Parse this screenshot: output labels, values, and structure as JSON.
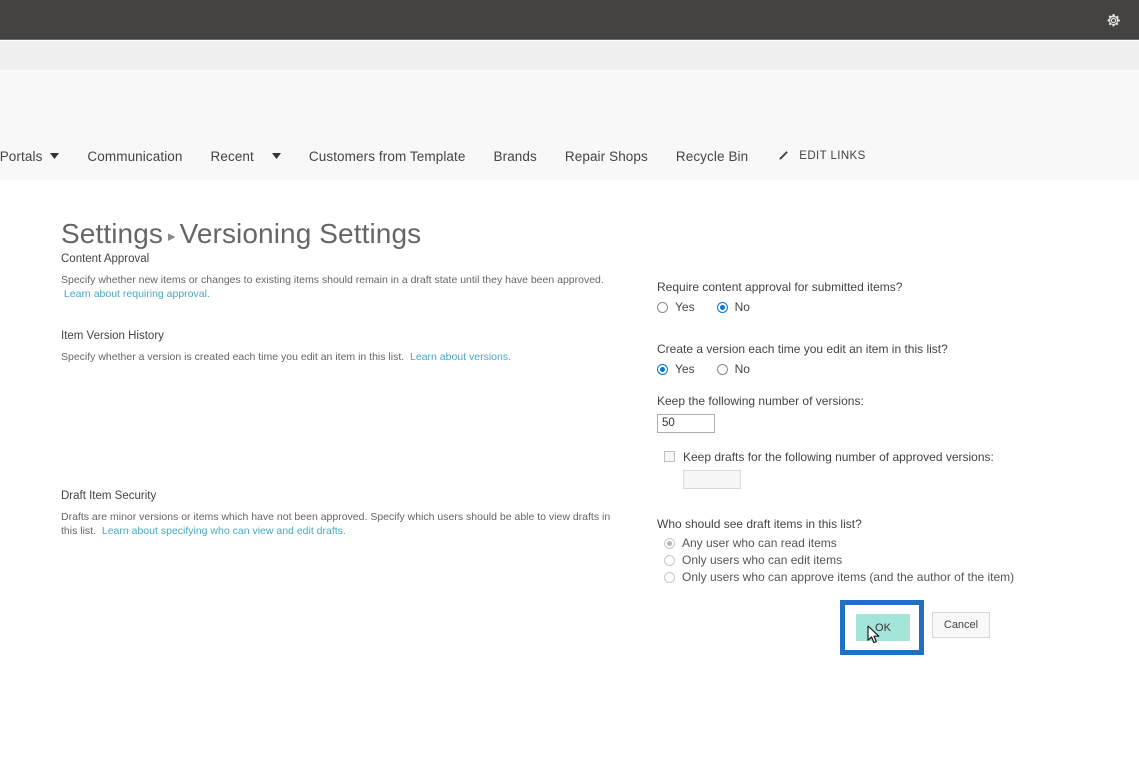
{
  "suite_bar": {
    "gear_icon": "gear-icon"
  },
  "top_nav": {
    "items": [
      {
        "label": "t Portals",
        "has_caret": true
      },
      {
        "label": "Communication",
        "has_caret": false
      },
      {
        "label": "Recent",
        "has_caret": true
      },
      {
        "label": "Customers from Template",
        "has_caret": false
      },
      {
        "label": "Brands",
        "has_caret": false
      },
      {
        "label": "Repair Shops",
        "has_caret": false
      },
      {
        "label": "Recycle Bin",
        "has_caret": false
      }
    ],
    "edit_links": {
      "label": "EDIT LINKS",
      "icon": "pencil-icon"
    }
  },
  "page": {
    "breadcrumb_parent": "Settings",
    "separator": "▸",
    "title": "Versioning Settings"
  },
  "sections": {
    "content_approval": {
      "heading": "Content Approval",
      "description": "Specify whether new items or changes to existing items should remain in a draft state until they have been approved.",
      "link_text": "Learn about requiring approval.",
      "question": "Require content approval for submitted items?",
      "options": [
        {
          "label": "Yes",
          "selected": false
        },
        {
          "label": "No",
          "selected": true
        }
      ]
    },
    "item_version_history": {
      "heading": "Item Version History",
      "description": "Specify whether a version is created each time you edit an item in this list.",
      "link_text": "Learn about versions.",
      "question": "Create a version each time you edit an item in this list?",
      "options": [
        {
          "label": "Yes",
          "selected": true
        },
        {
          "label": "No",
          "selected": false
        }
      ],
      "keep_versions_label": "Keep the following number of versions:",
      "keep_versions_value": "50",
      "keep_drafts_label": "Keep drafts for the following number of approved versions:",
      "keep_drafts_checked": false,
      "keep_drafts_value": ""
    },
    "draft_item_security": {
      "heading": "Draft Item Security",
      "description": "Drafts are minor versions or items which have not been approved. Specify which users should be able to view drafts in this list.",
      "link_text": "Learn about specifying who can view and edit drafts.",
      "question": "Who should see draft items in this list?",
      "options": [
        {
          "label": "Any user who can read items",
          "selected": true
        },
        {
          "label": "Only users who can edit items",
          "selected": false
        },
        {
          "label": "Only users who can approve items (and the author of the item)",
          "selected": false
        }
      ]
    }
  },
  "buttons": {
    "ok_label": "OK",
    "cancel_label": "Cancel"
  },
  "colors": {
    "suite_bar": "#444341",
    "accent_link": "#4aa8c0",
    "radio_selected": "#0078d7",
    "ok_highlight_fill": "#a4e5d9",
    "annotation_border": "#1f6fc4"
  }
}
